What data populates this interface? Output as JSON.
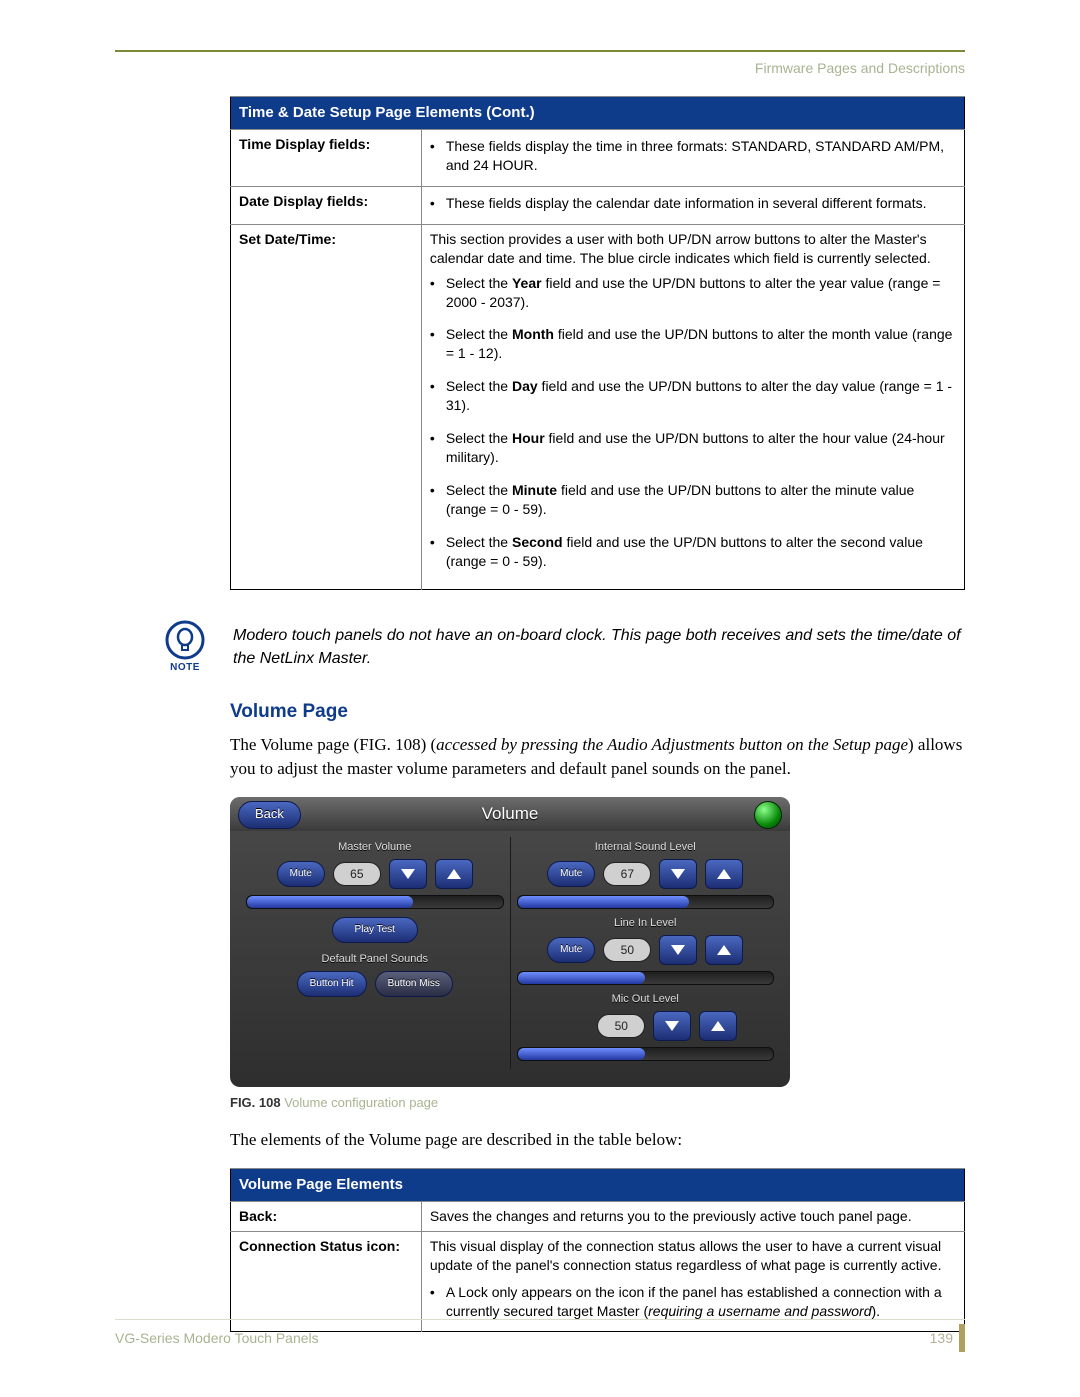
{
  "header": "Firmware Pages and Descriptions",
  "table1": {
    "title": "Time & Date Setup Page Elements (Cont.)",
    "rows": {
      "time_display": {
        "label": "Time Display fields:",
        "bullet": "These fields display the time in three formats: STANDARD, STANDARD AM/PM, and 24 HOUR."
      },
      "date_display": {
        "label": "Date Display fields:",
        "bullet": "These fields display the calendar date information in several different formats."
      },
      "set_dt": {
        "label": "Set Date/Time:",
        "intro": "This section provides a user with both UP/DN arrow buttons to alter the Master's calendar date and time. The blue circle indicates which field is currently selected.",
        "items": {
          "year": {
            "pre": "Select the ",
            "bold": "Year",
            "post": " field and use the UP/DN buttons to alter the year value (range = 2000 - 2037)."
          },
          "month": {
            "pre": "Select the ",
            "bold": "Month",
            "post": " field and use the UP/DN buttons to alter the month value (range = 1 - 12)."
          },
          "day": {
            "pre": "Select the ",
            "bold": "Day",
            "post": " field and use the UP/DN buttons to alter the day value (range = 1 - 31)."
          },
          "hour": {
            "pre": "Select the ",
            "bold": "Hour",
            "post": " field and use the UP/DN buttons to alter the hour value (24-hour military)."
          },
          "minute": {
            "pre": "Select the ",
            "bold": "Minute",
            "post": " field and use the UP/DN buttons to alter the minute value (range = 0 - 59)."
          },
          "second": {
            "pre": "Select the ",
            "bold": "Second",
            "post": " field and use the UP/DN buttons to alter the second value (range = 0 - 59)."
          }
        }
      }
    }
  },
  "note": {
    "label": "NOTE",
    "text": "Modero touch panels do not have an on-board clock. This page both receives and sets the time/date of the NetLinx Master."
  },
  "section": {
    "title": "Volume Page",
    "para_a": "The Volume page (FIG. 108) (",
    "para_b_italic": "accessed by pressing the Audio Adjustments button on the Setup page",
    "para_c": ") allows you to adjust the master volume parameters and default panel sounds on the panel."
  },
  "panel": {
    "back": "Back",
    "title": "Volume",
    "master_volume_label": "Master Volume",
    "internal_sound_label": "Internal Sound Level",
    "line_in_label": "Line In Level",
    "mic_out_label": "Mic Out Level",
    "default_sounds_label": "Default Panel Sounds",
    "mute": "Mute",
    "play_test": "Play Test",
    "button_hit": "Button Hit",
    "button_miss": "Button Miss",
    "values": {
      "master": "65",
      "internal": "67",
      "line_in": "50",
      "mic_out": "50"
    }
  },
  "figure": {
    "num": "FIG. 108",
    "caption": "  Volume configuration page"
  },
  "para2": "The elements of the Volume page are described in the table below:",
  "table2": {
    "title": "Volume Page Elements",
    "back": {
      "label": "Back:",
      "text": "Saves the changes and returns you to the previously active touch panel page."
    },
    "conn": {
      "label": "Connection Status icon:",
      "text": "This visual display of the connection status allows the user to have a current visual update of the panel's connection status regardless of what page is currently active.",
      "bullet_a": "A Lock only appears on the icon if the panel has established a connection with a currently secured target Master (",
      "bullet_b_italic": "requiring a username and password",
      "bullet_c": ")."
    }
  },
  "footer": {
    "left": "VG-Series Modero Touch Panels",
    "page": "139"
  }
}
